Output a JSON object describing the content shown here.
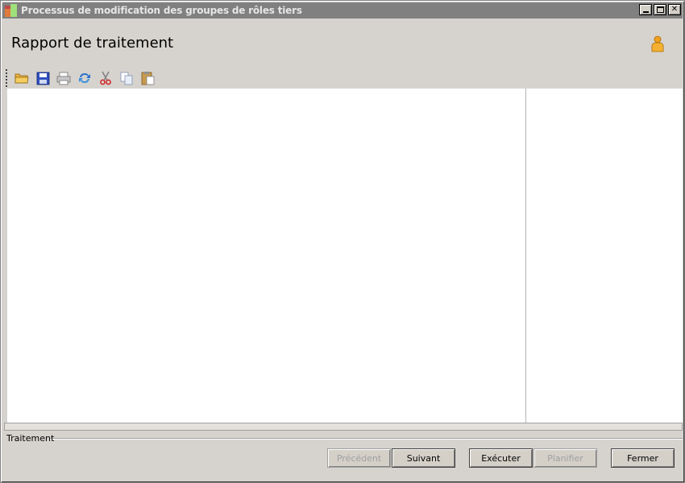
{
  "window": {
    "title": "Processus de modification des groupes de rôles tiers"
  },
  "header": {
    "title": "Rapport de traitement"
  },
  "toolbar": {
    "items": [
      {
        "name": "open-folder-icon"
      },
      {
        "name": "save-icon"
      },
      {
        "name": "print-icon"
      },
      {
        "name": "refresh-icon"
      },
      {
        "name": "cut-icon"
      },
      {
        "name": "copy-icon"
      },
      {
        "name": "paste-icon"
      }
    ]
  },
  "groupbox": {
    "label": "Traitement"
  },
  "buttons": {
    "previous": "Précédent",
    "next": "Suivant",
    "execute": "Exécuter",
    "schedule": "Planifier",
    "close": "Fermer"
  },
  "colors": {
    "titlebar": "#808080",
    "window_bg": "#d6d3ce",
    "content_bg": "#ffffff",
    "user_icon": "#f0a020"
  }
}
